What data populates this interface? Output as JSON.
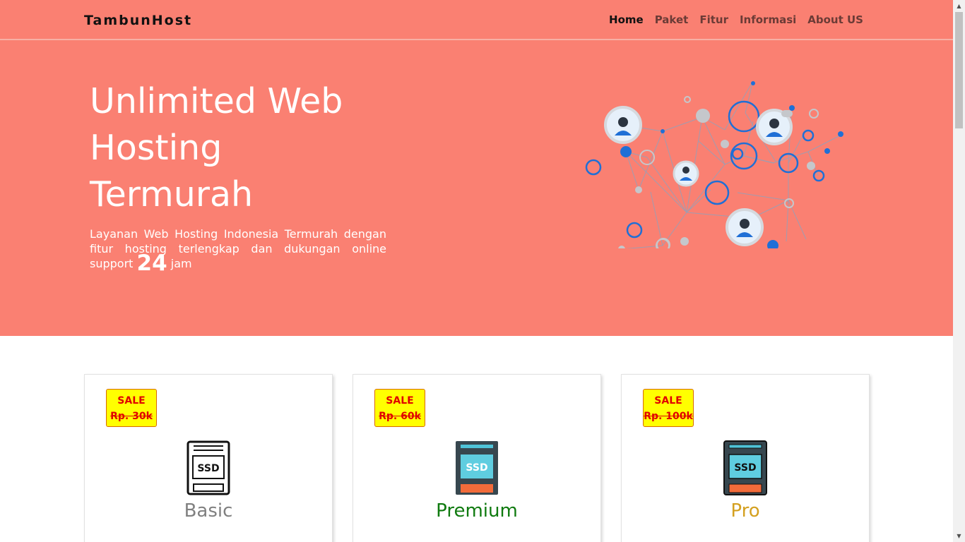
{
  "nav": {
    "brand": "TambunHost",
    "links": [
      "Home",
      "Paket",
      "Fitur",
      "Informasi",
      "About US"
    ]
  },
  "hero": {
    "title_lines": [
      "Unlimited Web",
      "Hosting",
      "Termurah"
    ],
    "desc_main": "Layanan Web Hosting Indonesia Termurah dengan fitur hosting terlengkap dan dukungan online support ",
    "desc_number": "24",
    "desc_end": " jam"
  },
  "plans": [
    {
      "sale_label": "SALE",
      "old_price": "Rp. 30k",
      "name": "Basic",
      "name_color": "#808080"
    },
    {
      "sale_label": "SALE",
      "old_price": "Rp. 60k",
      "name": "Premium",
      "name_color": "#0f7a0f"
    },
    {
      "sale_label": "SALE",
      "old_price": "Rp. 100k",
      "name": "Pro",
      "name_color": "#d4a020"
    }
  ],
  "ssd_label": "SSD",
  "colors": {
    "hero_bg": "#fa8072",
    "badge_bg": "#ffff00",
    "badge_text": "#e00000"
  },
  "icons": [
    "network-illustration",
    "ssd-icon",
    "scroll-up-icon",
    "scroll-down-icon"
  ]
}
